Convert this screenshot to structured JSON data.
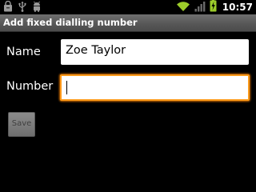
{
  "status_bar": {
    "time": "10:57",
    "icons": [
      "shopping-bag-icon",
      "usb-icon",
      "android-debug-icon",
      "wifi-icon",
      "signal-icon",
      "battery-charging-icon"
    ]
  },
  "title": "Add fixed dialling number",
  "form": {
    "name_label": "Name",
    "name_value": "Zoe Taylor",
    "number_label": "Number",
    "number_value": ""
  },
  "save_label": "Save",
  "colors": {
    "focus_accent": "#ff9a1a",
    "title_bar": "#5a5a5a",
    "background": "#000000"
  }
}
